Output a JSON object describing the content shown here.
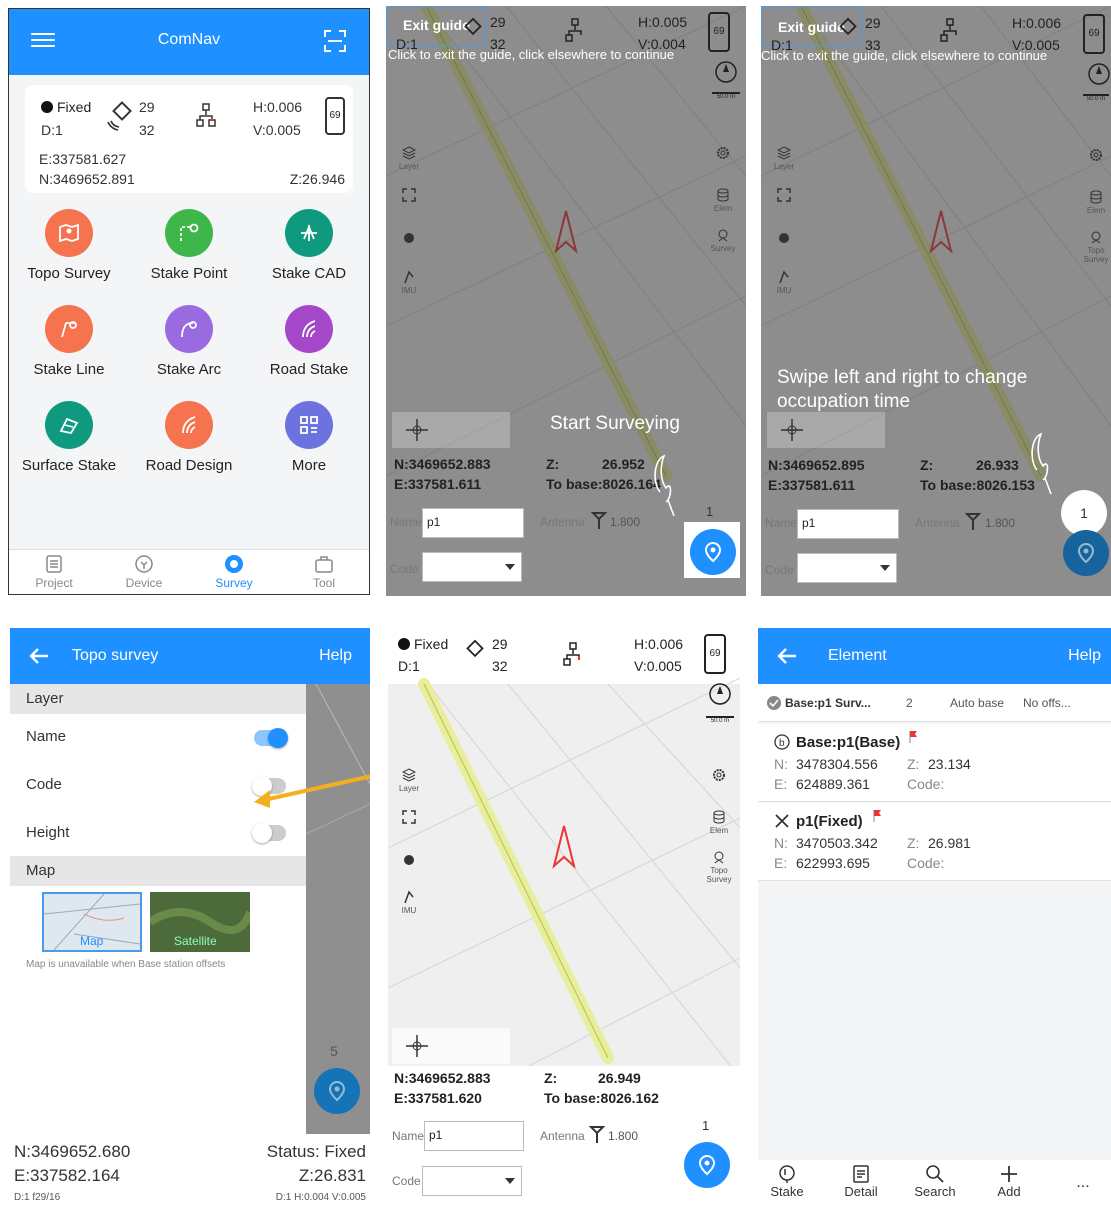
{
  "home": {
    "title": "ComNav",
    "status": {
      "fix": "Fixed",
      "diff": "D:1",
      "sat_used": "29",
      "sat_total": "32",
      "h_precision": "H:0.006",
      "v_precision": "V:0.005",
      "battery": "69",
      "easting": "E:337581.627",
      "northing": "N:3469652.891",
      "elevation": "Z:26.946"
    },
    "apps": [
      {
        "label": "Topo Survey",
        "color": "#f5734f"
      },
      {
        "label": "Stake Point",
        "color": "#3eb64a"
      },
      {
        "label": "Stake CAD",
        "color": "#0f9a7f"
      },
      {
        "label": "Stake Line",
        "color": "#f5734f"
      },
      {
        "label": "Stake Arc",
        "color": "#9a6be0"
      },
      {
        "label": "Road Stake",
        "color": "#a547c9"
      },
      {
        "label": "Surface Stake",
        "color": "#0f9a7f"
      },
      {
        "label": "Road Design",
        "color": "#f5734f"
      },
      {
        "label": "More",
        "color": "#6c73e0"
      }
    ],
    "nav": [
      "Project",
      "Device",
      "Survey",
      "Tool"
    ]
  },
  "guide1": {
    "exit": "Exit guide",
    "note": "Click to exit the guide, click elsewhere to continue",
    "message": "Start Surveying",
    "status": {
      "diff": "D:1",
      "sat_used": "29",
      "sat_total": "32",
      "h": "H:0.005",
      "v": "V:0.004",
      "battery": "69"
    },
    "scale": "50.0 m",
    "side_left": [
      "Layer",
      "",
      "",
      "IMU"
    ],
    "side_right": [
      "",
      "Elem",
      "Survey"
    ],
    "north": "N:3469652.883",
    "east": "E:337581.611",
    "z_label": "Z:",
    "z_value": "26.952",
    "base": "To base:8026.164",
    "name_label": "Name",
    "name_value": "p1",
    "antenna_label": "Antenna",
    "antenna_value": "1.800",
    "count": "1",
    "code_label": "Code"
  },
  "guide2": {
    "exit": "Exit guide",
    "note": "Click to exit the guide, click elsewhere to continue",
    "message": "Swipe left and right to change occupation time",
    "status": {
      "diff": "D:1",
      "sat_used": "29",
      "sat_total": "33",
      "h": "H:0.006",
      "v": "V:0.005",
      "battery": "69"
    },
    "scale": "50.0 m",
    "side_left": [
      "Layer",
      "",
      "",
      "IMU"
    ],
    "side_right": [
      "",
      "Elem",
      "Topo Survey"
    ],
    "north": "N:3469652.895",
    "east": "E:337581.611",
    "z_label": "Z:",
    "z_value": "26.933",
    "base": "To base:8026.153",
    "name_label": "Name",
    "name_value": "p1",
    "antenna_label": "Antenna",
    "antenna_value": "1.800",
    "count": "1",
    "code_label": "Code"
  },
  "layer": {
    "title": "Topo survey",
    "help": "Help",
    "section_layer": "Layer",
    "rows": [
      "Name",
      "Code",
      "Height"
    ],
    "row_states": [
      true,
      false,
      false
    ],
    "section_map": "Map",
    "map_label": "Map",
    "satellite_label": "Satellite",
    "note": "Map is unavailable when Base station offsets",
    "count": "5",
    "north": "N:3469652.680",
    "east": "E:337582.164",
    "status": "Status: Fixed",
    "z": "Z:26.831",
    "footer_left": "D:1 f29/16",
    "footer_right": "D:1 H:0.004 V:0.005"
  },
  "survey": {
    "status": {
      "fix": "Fixed",
      "diff": "D:1",
      "sat_used": "29",
      "sat_total": "32",
      "h": "H:0.006",
      "v": "V:0.005",
      "battery": "69"
    },
    "scale": "50.0 m",
    "side_left": [
      "Layer",
      "",
      "",
      "IMU"
    ],
    "side_right": [
      "",
      "Elem",
      "Topo Survey"
    ],
    "north": "N:3469652.883",
    "east": "E:337581.620",
    "z_label": "Z:",
    "z_value": "26.949",
    "base": "To base:8026.162",
    "name_label": "Name",
    "name_value": "p1",
    "antenna_label": "Antenna",
    "antenna_value": "1.800",
    "count": "1",
    "code_label": "Code"
  },
  "element": {
    "title": "Element",
    "help": "Help",
    "filter": {
      "base": "Base:p1 Surv...",
      "count": "2",
      "auto": "Auto base",
      "offset": "No offs..."
    },
    "items": [
      {
        "name": "Base:p1(Base)",
        "n": "3478304.556",
        "e": "624889.361",
        "z": "23.134"
      },
      {
        "name": "p1(Fixed)",
        "n": "3470503.342",
        "e": "622993.695",
        "z": "26.981"
      }
    ],
    "labels": {
      "n": "N:",
      "e": "E:",
      "z": "Z:",
      "code": "Code:"
    },
    "nav": [
      "Stake",
      "Detail",
      "Search",
      "Add",
      "..."
    ]
  },
  "colors": {
    "primary": "#1e90ff",
    "road": "#e8ee9a"
  }
}
